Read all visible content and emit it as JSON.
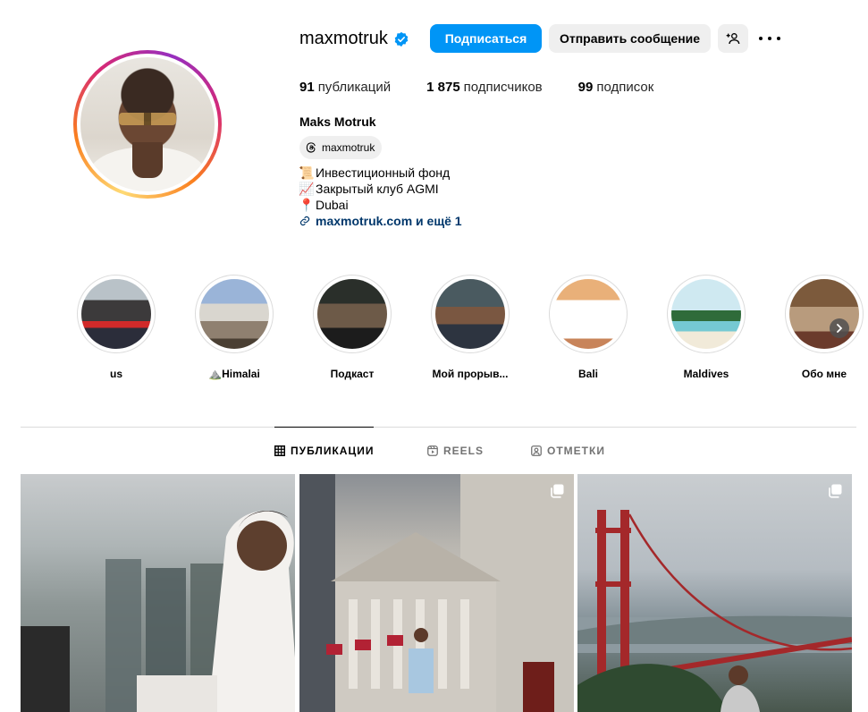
{
  "profile": {
    "username": "maxmotruk",
    "verified": true,
    "follow_label": "Подписаться",
    "message_label": "Отправить сообщение",
    "add_user_icon": "add-user-icon",
    "more_icon": "more-options-icon",
    "stats": {
      "posts_count": "91",
      "posts_label": "публикаций",
      "followers_count": "1 875",
      "followers_label": "подписчиков",
      "following_count": "99",
      "following_label": "подписок"
    },
    "full_name": "Maks Motruk",
    "threads_handle": "maxmotruk",
    "bio": [
      {
        "emoji": "📜",
        "text": "Инвестиционный фонд"
      },
      {
        "emoji": "📈",
        "text": "Закрытый клуб AGMI"
      },
      {
        "emoji": "📍",
        "text": "Dubai"
      }
    ],
    "link_text": "maxmotruk.com и ещё 1"
  },
  "highlights": [
    {
      "label": "us"
    },
    {
      "label": "⛰️Himalai"
    },
    {
      "label": "Подкаст"
    },
    {
      "label": "Мой прорыв..."
    },
    {
      "label": "Bali"
    },
    {
      "label": "Maldives"
    },
    {
      "label": "Обо мне"
    }
  ],
  "tabs": [
    {
      "label": "ПУБЛИКАЦИИ",
      "icon": "grid-icon",
      "active": true
    },
    {
      "label": "REELS",
      "icon": "reels-icon",
      "active": false
    },
    {
      "label": "ОТМЕТКИ",
      "icon": "tagged-icon",
      "active": false
    }
  ],
  "colors": {
    "accent": "#0095f6",
    "button_gray": "#efefef",
    "link": "#00376b"
  }
}
